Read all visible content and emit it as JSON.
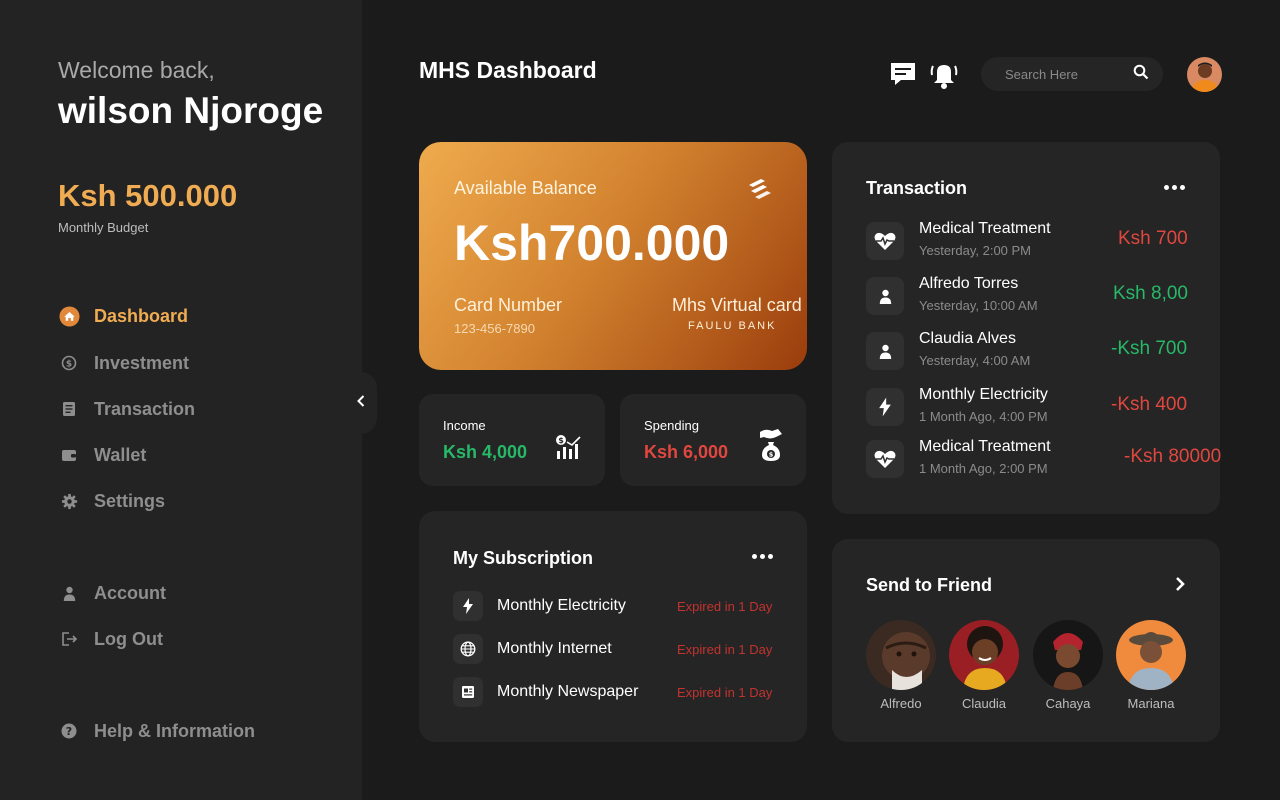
{
  "sidebar": {
    "welcome": "Welcome back,",
    "username": "wilson Njoroge",
    "budget_amount": "Ksh 500.000",
    "budget_label": "Monthly Budget",
    "nav": [
      {
        "label": "Dashboard",
        "icon": "home-icon"
      },
      {
        "label": "Investment",
        "icon": "investment-icon"
      },
      {
        "label": "Transaction",
        "icon": "receipt-icon"
      },
      {
        "label": "Wallet",
        "icon": "wallet-icon"
      },
      {
        "label": "Settings",
        "icon": "gear-icon"
      }
    ],
    "account_label": "Account",
    "logout_label": "Log Out",
    "help_label": "Help & Information"
  },
  "header": {
    "title": "MHS Dashboard",
    "search_placeholder": "Search Here"
  },
  "balance_card": {
    "label": "Available Balance",
    "amount": "Ksh700.000",
    "card_number_label": "Card Number",
    "card_number": "123-456-7890",
    "card_type": "Mhs Virtual card",
    "bank": "FAULU BANK"
  },
  "income": {
    "label": "Income",
    "value": "Ksh 4,000"
  },
  "spending": {
    "label": "Spending",
    "value": "Ksh 6,000"
  },
  "subscription": {
    "title": "My Subscription",
    "items": [
      {
        "name": "Monthly Electricity",
        "status": "Expired in 1 Day",
        "icon": "bolt-icon"
      },
      {
        "name": "Monthly Internet",
        "status": "Expired in 1 Day",
        "icon": "globe-icon"
      },
      {
        "name": "Monthly Newspaper",
        "status": "Expired in 1 Day",
        "icon": "newspaper-icon"
      }
    ]
  },
  "transactions": {
    "title": "Transaction",
    "items": [
      {
        "name": "Medical Treatment",
        "time": "Yesterday, 2:00 PM",
        "amount": "Ksh 700",
        "status": "red",
        "icon": "heartbeat-icon"
      },
      {
        "name": "Alfredo Torres",
        "time": "Yesterday, 10:00 AM",
        "amount": "Ksh 8,00",
        "status": "green",
        "icon": "person-icon"
      },
      {
        "name": "Claudia Alves",
        "time": "Yesterday, 4:00 AM",
        "amount": "-Ksh 700",
        "status": "green",
        "icon": "person-icon"
      },
      {
        "name": "Monthly Electricity",
        "time": "1 Month Ago, 4:00 PM",
        "amount": "-Ksh 400",
        "status": "red",
        "icon": "bolt-icon"
      },
      {
        "name": "Medical Treatment",
        "time": "1 Month Ago, 2:00 PM",
        "amount": "-Ksh 80000",
        "status": "red",
        "icon": "heartbeat-icon"
      }
    ]
  },
  "send_to_friend": {
    "title": "Send to Friend",
    "friends": [
      {
        "name": "Alfredo"
      },
      {
        "name": "Claudia"
      },
      {
        "name": "Cahaya"
      },
      {
        "name": "Mariana"
      }
    ]
  },
  "colors": {
    "accent": "#f0ac52",
    "positive": "#27b868",
    "negative": "#e0473f",
    "background": "#1b1b1b",
    "panel": "#252525"
  }
}
